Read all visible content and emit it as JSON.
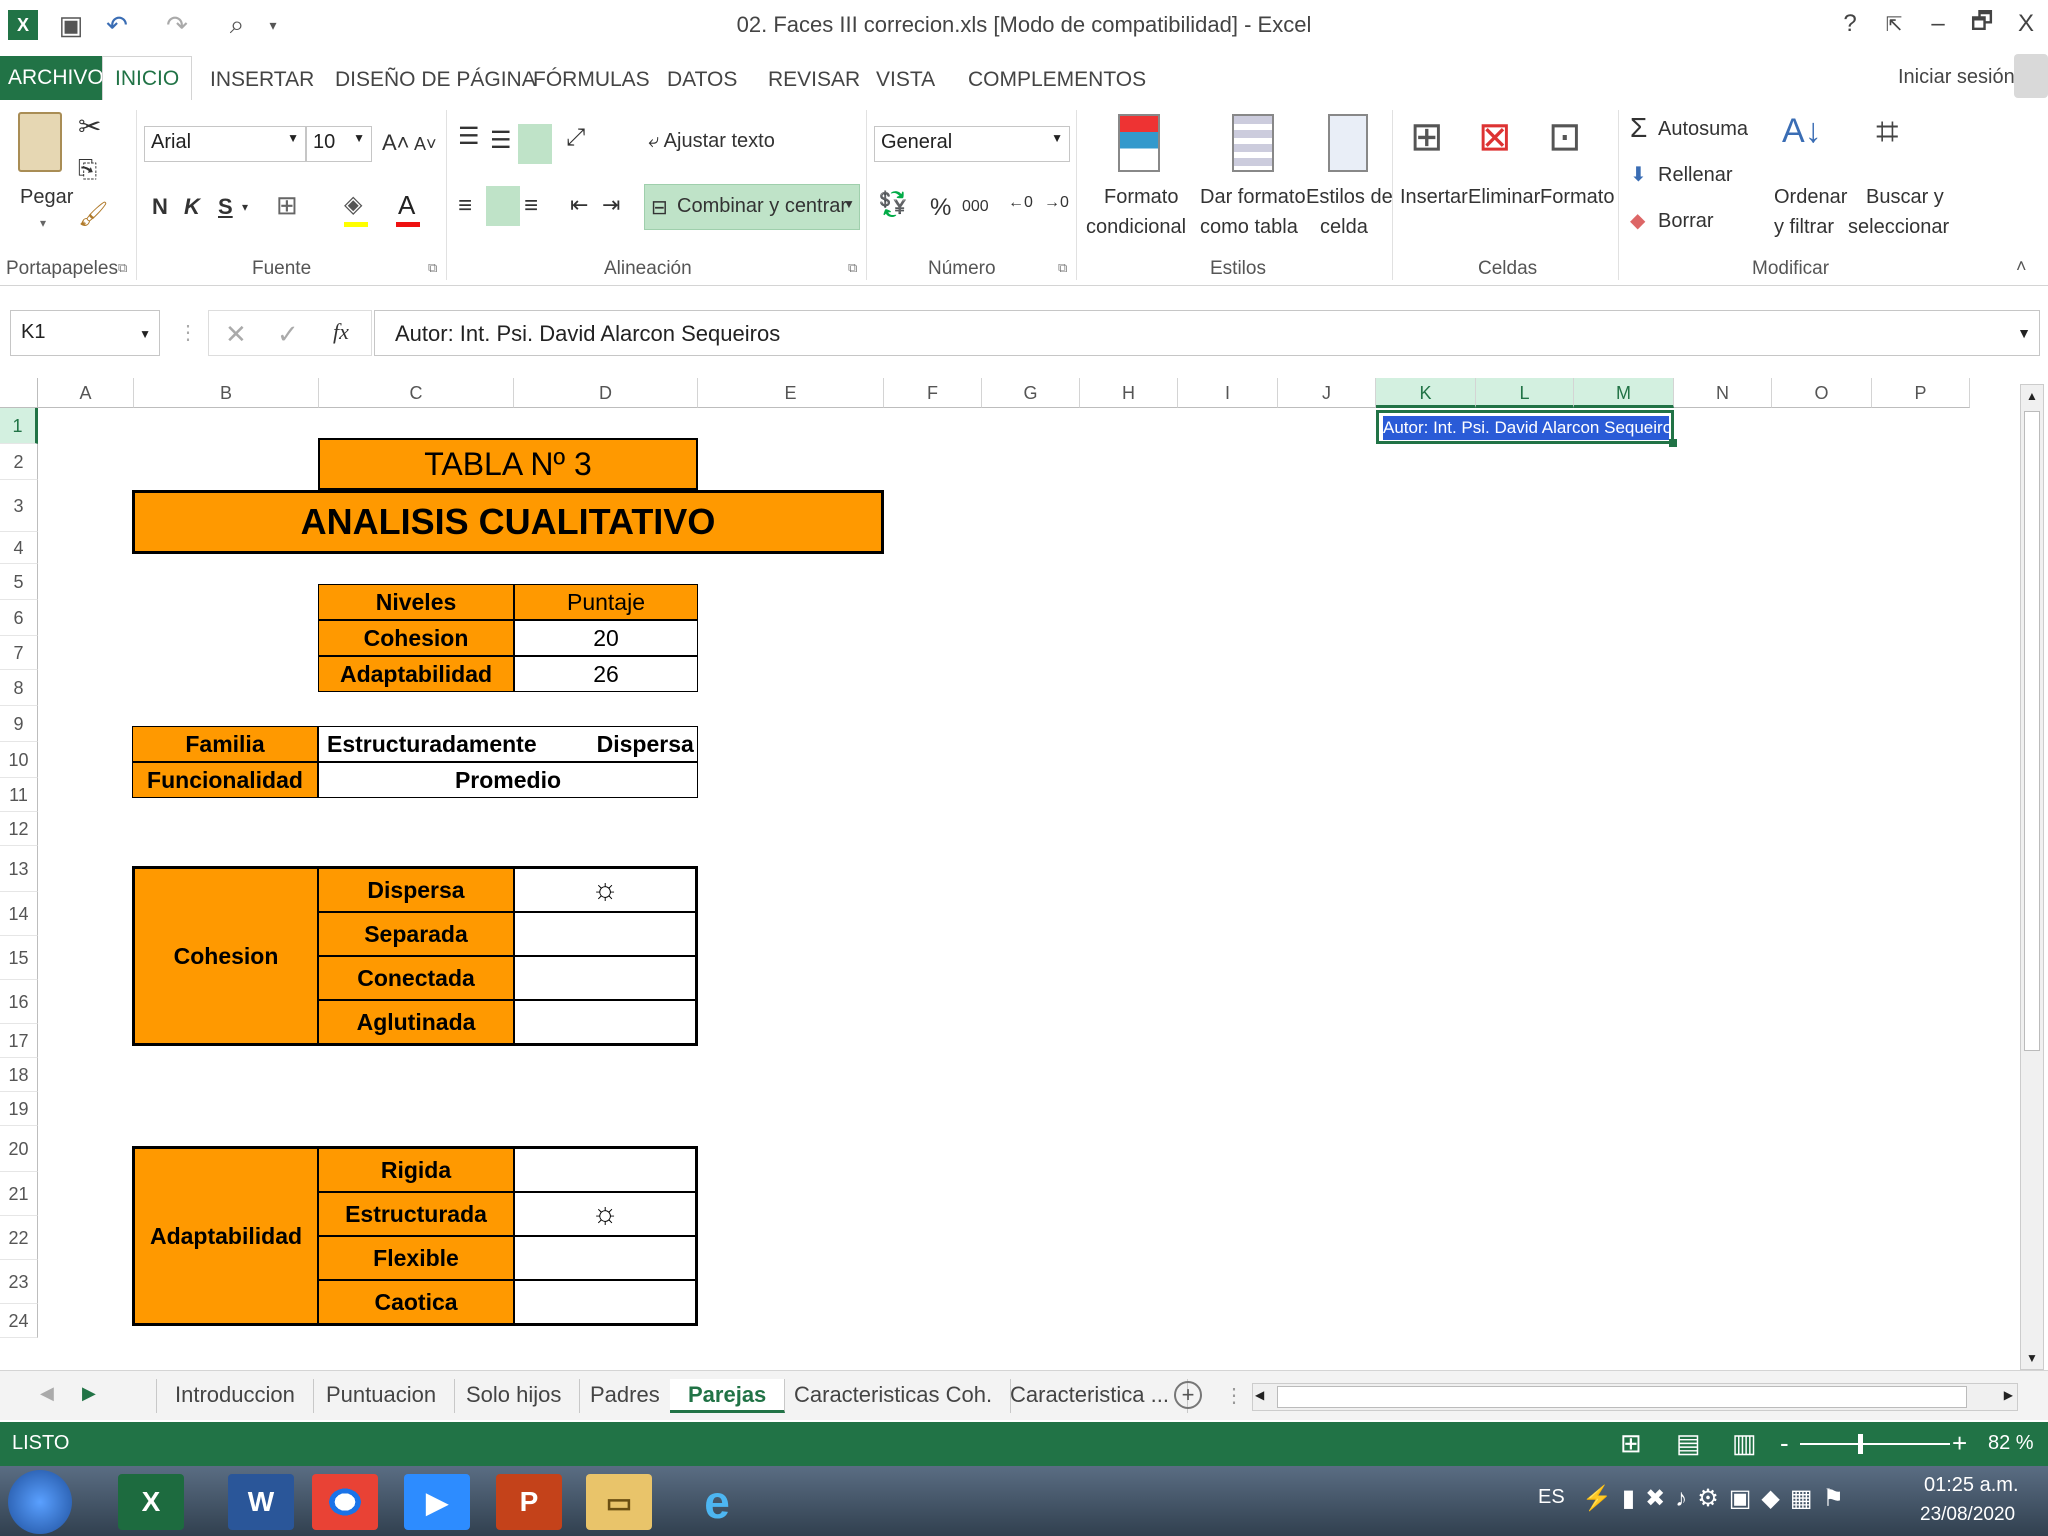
{
  "window": {
    "title": "02. Faces III correcion.xls  [Modo de compatibilidad] - Excel",
    "help": "?",
    "minimize": "–",
    "restore": "🗗",
    "close": "X"
  },
  "ribbon_tabs": {
    "file": "ARCHIVO",
    "items": [
      "INICIO",
      "INSERTAR",
      "DISEÑO DE PÁGINA",
      "FÓRMULAS",
      "DATOS",
      "REVISAR",
      "VISTA",
      "COMPLEMENTOS"
    ],
    "signin": "Iniciar sesión"
  },
  "ribbon": {
    "paste": "Pegar",
    "font_name": "Arial",
    "font_size": "10",
    "bold": "N",
    "italic": "K",
    "underline": "S",
    "wrap_text": "Ajustar texto",
    "merge_center": "Combinar y centrar",
    "number_format": "General",
    "percent": "%",
    "thousands": "000",
    "cond_format_1": "Formato",
    "cond_format_2": "condicional",
    "table_format_1": "Dar formato",
    "table_format_2": "como tabla",
    "cell_styles_1": "Estilos de",
    "cell_styles_2": "celda",
    "insert": "Insertar",
    "delete": "Eliminar",
    "format": "Formato",
    "autosum": "Autosuma",
    "fill": "Rellenar",
    "clear": "Borrar",
    "sort_1": "Ordenar",
    "sort_2": "y filtrar",
    "find_1": "Buscar y",
    "find_2": "seleccionar",
    "groups": {
      "clipboard": "Portapapeles",
      "font": "Fuente",
      "alignment": "Alineación",
      "number": "Número",
      "styles": "Estilos",
      "cells": "Celdas",
      "editing": "Modificar"
    }
  },
  "formula_bar": {
    "name_box": "K1",
    "fx": "fx",
    "content": "Autor: Int. Psi. David Alarcon Sequeiros"
  },
  "columns": [
    "A",
    "B",
    "C",
    "D",
    "E",
    "F",
    "G",
    "H",
    "I",
    "J",
    "K",
    "L",
    "M",
    "N",
    "O",
    "P"
  ],
  "rows": [
    "1",
    "2",
    "3",
    "4",
    "5",
    "6",
    "7",
    "8",
    "9",
    "10",
    "11",
    "12",
    "13",
    "14",
    "15",
    "16",
    "17",
    "18",
    "19",
    "20",
    "21",
    "22",
    "23",
    "24"
  ],
  "sheet": {
    "k1_author": "Autor: Int. Psi. David Alarcon Sequeiros",
    "tabla_title": "TABLA Nº 3",
    "analisis_title": "ANALISIS CUALITATIVO",
    "niveles_header": "Niveles",
    "puntaje_header": "Puntaje",
    "cohesion_label": "Cohesion",
    "cohesion_score": "20",
    "adaptabilidad_label": "Adaptabilidad",
    "adaptabilidad_score": "26",
    "familia_label": "Familia",
    "familia_value_1": "Estructuradamente",
    "familia_value_2": "Dispersa",
    "funcionalidad_label": "Funcionalidad",
    "funcionalidad_value": "Promedio",
    "cohesion_group": "Cohesion",
    "cohesion_levels": [
      "Dispersa",
      "Separada",
      "Conectada",
      "Aglutinada"
    ],
    "cohesion_marks": [
      "☼",
      "",
      "",
      ""
    ],
    "adapt_group": "Adaptabilidad",
    "adapt_levels": [
      "Rigida",
      "Estructurada",
      "Flexible",
      "Caotica"
    ],
    "adapt_marks": [
      "",
      "☼",
      "",
      ""
    ]
  },
  "sheet_tabs": [
    "Introduccion",
    "Puntuacion",
    "Solo hijos",
    "Padres",
    "Parejas",
    "Caracteristicas Coh.",
    "Caracteristica ..."
  ],
  "active_sheet": "Parejas",
  "status": {
    "mode": "LISTO",
    "zoom": "82 %"
  },
  "taskbar": {
    "lang": "ES",
    "time": "01:25 a.m.",
    "date": "23/08/2020"
  },
  "colors": {
    "excel_green": "#217346",
    "orange": "#ff9900"
  }
}
